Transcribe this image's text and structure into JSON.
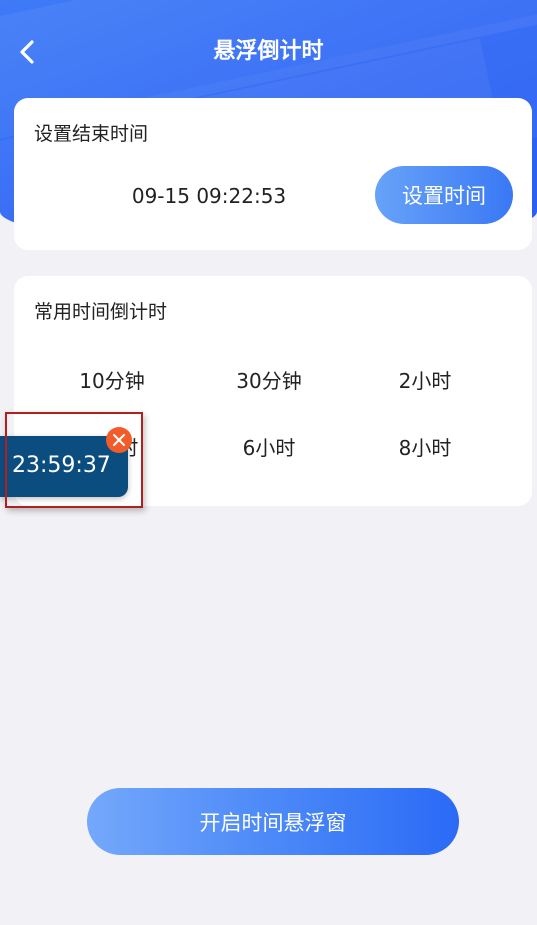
{
  "header": {
    "title": "悬浮倒计时",
    "back_icon": "chevron-left-icon"
  },
  "end_time_card": {
    "title": "设置结束时间",
    "value": "09-15 09:22:53",
    "set_button_label": "设置时间"
  },
  "common_card": {
    "title": "常用时间倒计时",
    "presets": [
      "10分钟",
      "30分钟",
      "2小时",
      "4小时",
      "6小时",
      "8小时"
    ]
  },
  "floating_widget": {
    "time": "23:59:37",
    "close_icon": "close-icon",
    "background": "#0c4d80",
    "close_color": "#f25c2a"
  },
  "footer": {
    "start_button_label": "开启时间悬浮窗"
  },
  "colors": {
    "header": "#2f66f5",
    "page_background": "#f2f1f5",
    "highlight_border": "#b0201e"
  }
}
